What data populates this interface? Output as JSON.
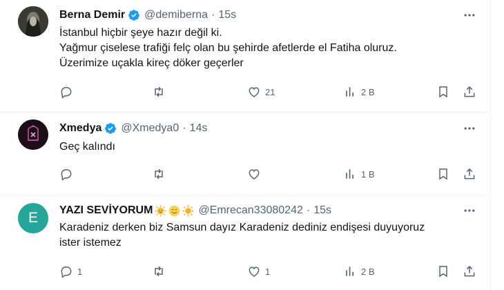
{
  "tweets": [
    {
      "name": "Berna Demir",
      "handle": "@demiberna",
      "dot": "·",
      "time": "15s",
      "lines": [
        "İstanbul hiçbir şeye hazır değil ki.",
        "Yağmur çiselese trafiği felç olan bu şehirde afetlerde el Fatiha oluruz.",
        "Üzerimize uçakla kireç döker geçerler"
      ],
      "reply_count": "",
      "retweet_count": "",
      "like_count": "21",
      "view_count": "2 B",
      "verified": true,
      "avatar_icon": "dark-figure-avatar"
    },
    {
      "name": "Xmedya",
      "handle": "@Xmedya0",
      "dot": "·",
      "time": "14s",
      "lines": [
        "Geç kalındı"
      ],
      "reply_count": "",
      "retweet_count": "",
      "like_count": "",
      "view_count": "1 B",
      "verified": true,
      "avatar_icon": "lantern-logo-avatar"
    },
    {
      "name": "YAZI SEVİYORUM",
      "handle": "@Emrecan33080242",
      "dot": "·",
      "time": "15s",
      "lines": [
        "Karadeniz derken biz Samsun dayız Karadeniz dediniz endişesi duyuyoruz",
        "ister istemez"
      ],
      "reply_count": "1",
      "retweet_count": "",
      "like_count": "1",
      "view_count": "2 B",
      "verified": false,
      "avatar_letter": "E",
      "emojis": [
        "sun-face-emoji",
        "smiling-face-emoji",
        "sun-emoji"
      ]
    }
  ],
  "colors": {
    "text": "#0f1419",
    "secondary": "#536471",
    "verified_blue": "#1d9bf0",
    "avatar_teal": "#26a69a"
  }
}
